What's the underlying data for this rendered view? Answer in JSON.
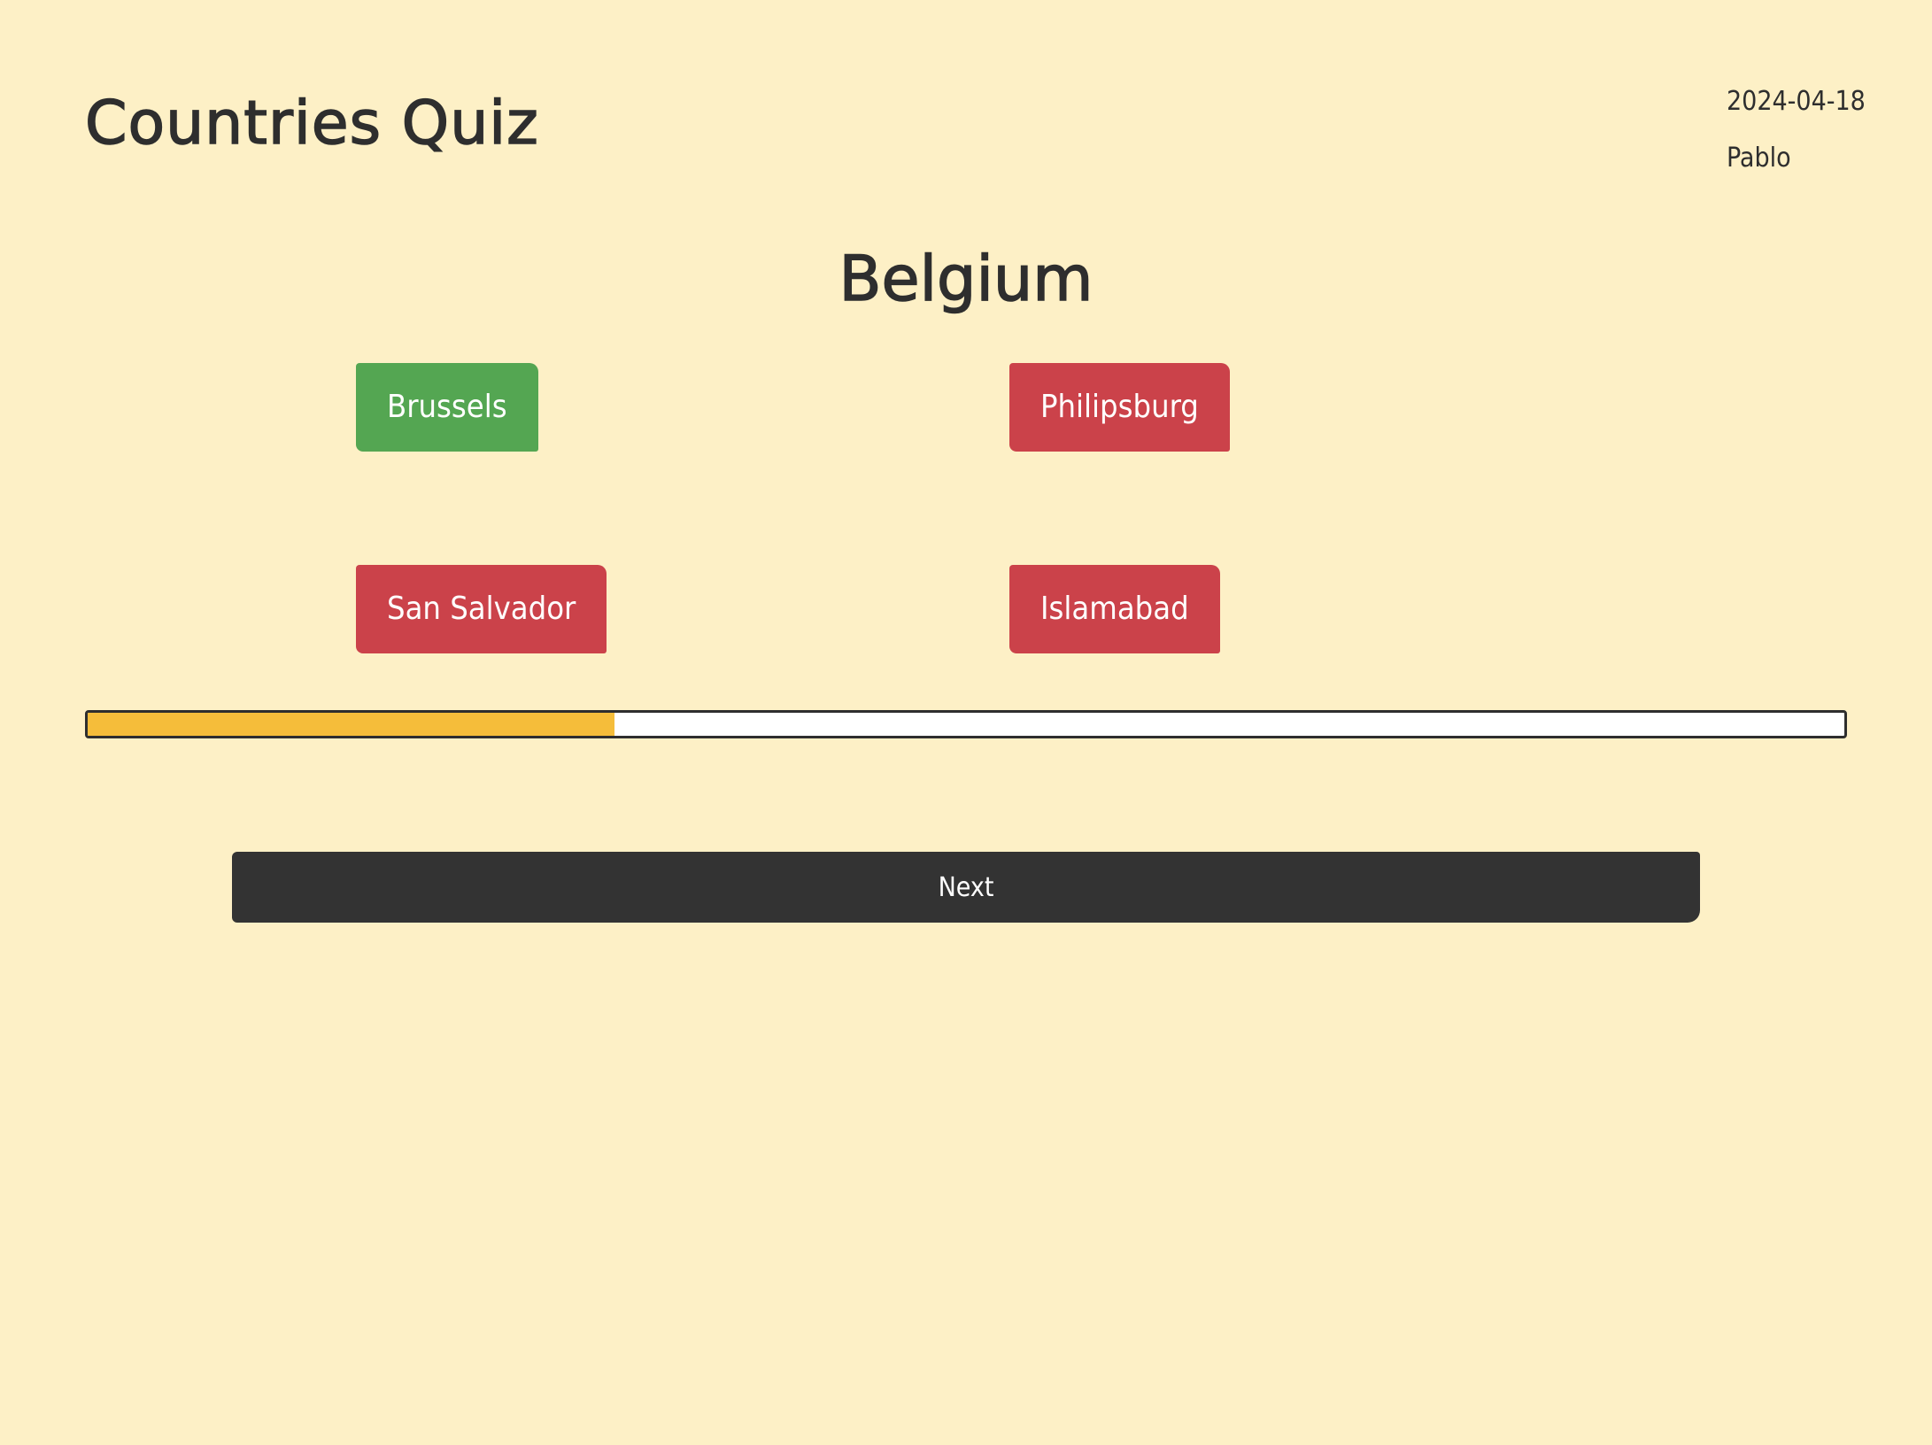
{
  "header": {
    "title": "Countries Quiz",
    "date": "2024-04-18",
    "user": "Pablo"
  },
  "question": {
    "country": "Belgium"
  },
  "answers": [
    {
      "label": "Brussels",
      "state": "correct"
    },
    {
      "label": "Philipsburg",
      "state": "wrong"
    },
    {
      "label": "San Salvador",
      "state": "wrong"
    },
    {
      "label": "Islamabad",
      "state": "wrong"
    }
  ],
  "progress": {
    "fraction": 0.3
  },
  "actions": {
    "next_label": "Next"
  },
  "colors": {
    "background": "#fdf0c6",
    "correct": "#54a652",
    "wrong": "#cb424a",
    "progress_fill": "#f5bd3a",
    "next_button": "#333333",
    "text": "#2e2e2e"
  }
}
